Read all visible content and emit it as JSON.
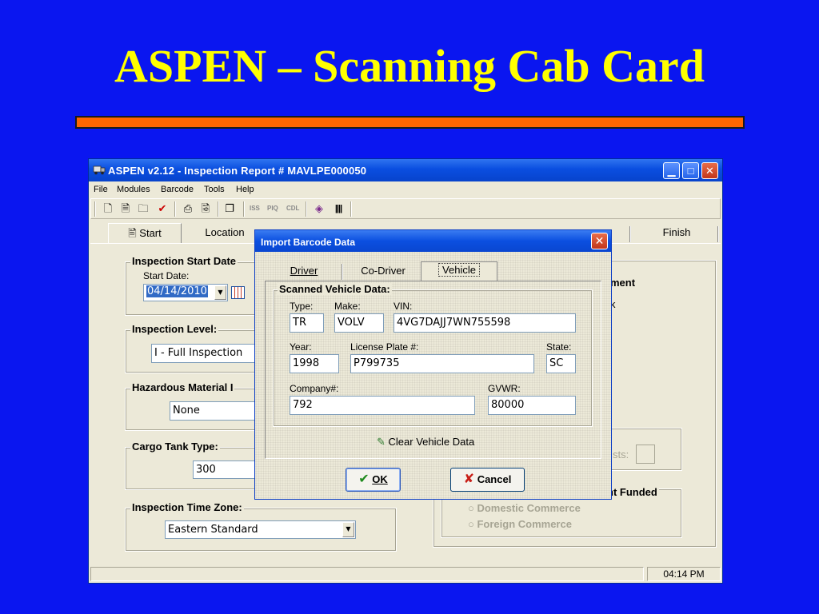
{
  "slide": {
    "title": "ASPEN – Scanning Cab Card"
  },
  "window": {
    "title": "ASPEN v2.12 - Inspection Report # MAVLPE000050",
    "menu": [
      "File",
      "Modules",
      "Barcode",
      "Tools",
      "Help"
    ],
    "toolbar_text": [
      "ISS",
      "PIQ",
      "CDL"
    ],
    "tabs": {
      "start": "Start",
      "location": "Location",
      "finish": "Finish"
    },
    "groups": {
      "start_date": {
        "label": "Inspection Start Date",
        "sublabel": "Start Date:",
        "value": "04/14/2010"
      },
      "level": {
        "label": "Inspection Level:",
        "value": "I - Full Inspection"
      },
      "hazmat": {
        "label": "Hazardous Material I",
        "value": "None"
      },
      "cargo": {
        "label": "Cargo Tank Type:",
        "value": "300"
      },
      "timezone": {
        "label": "Inspection Time Zone:",
        "value": "Eastern Standard"
      }
    },
    "right_partial": {
      "ment": "ment",
      "k": "k",
      "sts": "sts:",
      "funded": "nt Funded"
    },
    "commerce": [
      "Domestic Commerce",
      "Foreign Commerce"
    ],
    "status_time": "04:14 PM"
  },
  "dialog": {
    "title": "Import Barcode Data",
    "tabs": [
      "Driver",
      "Co-Driver",
      "Vehicle"
    ],
    "active_tab": "Vehicle",
    "group_label": "Scanned Vehicle Data:",
    "labels": {
      "type": "Type:",
      "make": "Make:",
      "vin": "VIN:",
      "year": "Year:",
      "plate": "License Plate #:",
      "state": "State:",
      "company": "Company#:",
      "gvwr": "GVWR:"
    },
    "values": {
      "type": "TR",
      "make": "VOLV",
      "vin": "4VG7DAJJ7WN755598",
      "year": "1998",
      "plate": "P799735",
      "state": "SC",
      "company": "792",
      "gvwr": "80000"
    },
    "clear_label": "Clear Vehicle Data",
    "ok_label": "OK",
    "cancel_label": "Cancel"
  }
}
